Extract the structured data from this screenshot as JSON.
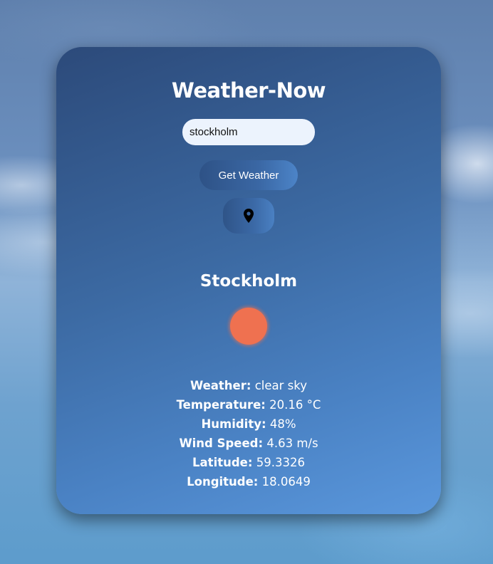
{
  "app": {
    "title": "Weather-Now"
  },
  "search": {
    "value": "stockholm",
    "placeholder": ""
  },
  "buttons": {
    "get_weather_label": "Get Weather",
    "location_icon": "map-pin-icon"
  },
  "result": {
    "city": "Stockholm",
    "icon": "sun-icon",
    "details": [
      {
        "label": "Weather:",
        "value": "clear sky"
      },
      {
        "label": "Temperature:",
        "value": "20.16 °C"
      },
      {
        "label": "Humidity:",
        "value": "48%"
      },
      {
        "label": "Wind Speed:",
        "value": "4.63 m/s"
      },
      {
        "label": "Latitude:",
        "value": "59.3326"
      },
      {
        "label": "Longitude:",
        "value": "18.0649"
      }
    ]
  },
  "colors": {
    "card_gradient_start": "#2c4a7a",
    "card_gradient_end": "#5a97dc",
    "input_bg": "#ecf3fd",
    "sun": "#ef7150",
    "text": "#ffffff"
  }
}
